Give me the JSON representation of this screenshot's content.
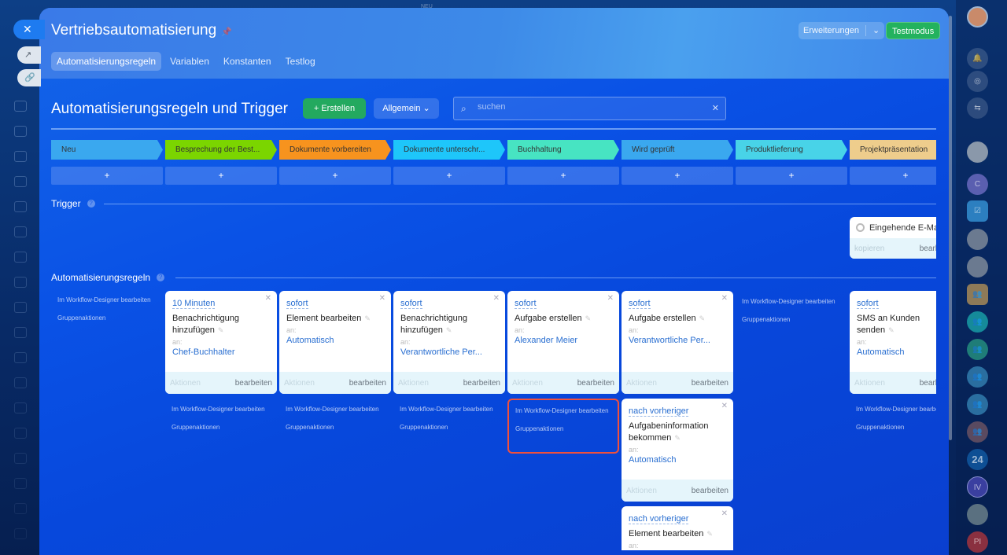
{
  "top_badge": "NEU",
  "left_sidebar": {
    "close": "✕",
    "open_icon": "↗",
    "link_icon": "🔗",
    "icons": [
      "feed-icon",
      "chat-icon",
      "contacts-icon",
      "crm-icon",
      "tasks-icon",
      "mail-icon",
      "calendar-icon",
      "funnel-icon",
      "cards-icon",
      "cart-icon",
      "target-icon",
      "chart-icon",
      "phone-icon",
      "robot-icon",
      "store-icon",
      "box-icon",
      "pencil-icon",
      "check-icon"
    ]
  },
  "header": {
    "title": "Vertriebsautomatisierung",
    "tabs": [
      "Automatisierungsregeln",
      "Variablen",
      "Konstanten",
      "Testlog"
    ],
    "extensions": "Erweiterungen",
    "test_mode": "Testmodus"
  },
  "toolbar": {
    "title": "Automatisierungsregeln und Trigger",
    "create": "+ Erstellen",
    "general": "Allgemein ⌄",
    "search_placeholder": "suchen"
  },
  "stages": [
    {
      "label": "Neu",
      "color": "#3aa8ef"
    },
    {
      "label": "Besprechung der Best...",
      "color": "#7bd500"
    },
    {
      "label": "Dokumente vorbereiten",
      "color": "#f7931e"
    },
    {
      "label": "Dokumente unterschr...",
      "color": "#1ec6fa"
    },
    {
      "label": "Buchhaltung",
      "color": "#47e4c2"
    },
    {
      "label": "Wird geprüft",
      "color": "#3aa8ef"
    },
    {
      "label": "Produktlieferung",
      "color": "#48d3e8"
    },
    {
      "label": "Projektpräsentation",
      "color": "#eecd8c"
    }
  ],
  "triggers": {
    "heading": "Trigger",
    "card": {
      "title": "Eingehende E-Mail",
      "copy": "kopieren",
      "edit": "bearbeiten"
    }
  },
  "rules": {
    "heading": "Automatisierungsregeln",
    "link_designer": "Im Workflow-Designer bearbeiten",
    "link_group": "Gruppenaktionen",
    "to_label": "an:",
    "actions": "Aktionen",
    "edit": "bearbeiten",
    "columns": [
      {
        "cards": []
      },
      {
        "cards": [
          {
            "delay": "10 Minuten",
            "name": "Benachrichtigung hinzufügen",
            "to": "Chef-Buchhalter"
          }
        ]
      },
      {
        "cards": [
          {
            "delay": "sofort",
            "name": "Element bearbeiten",
            "to": "Automatisch"
          }
        ]
      },
      {
        "cards": [
          {
            "delay": "sofort",
            "name": "Benachrichtigung hinzufügen",
            "to": "Verantwortliche Per..."
          }
        ]
      },
      {
        "cards": [
          {
            "delay": "sofort",
            "name": "Aufgabe erstellen",
            "to": "Alexander Meier"
          }
        ]
      },
      {
        "cards": [
          {
            "delay": "sofort",
            "name": "Aufgabe erstellen",
            "to": "Verantwortliche Per..."
          },
          {
            "delay": "nach vorheriger",
            "name": "Aufgabeninformation bekommen",
            "to": "Automatisch"
          },
          {
            "delay": "nach vorheriger",
            "name": "Element bearbeiten",
            "to": ""
          }
        ]
      },
      {
        "cards": []
      },
      {
        "cards": [
          {
            "delay": "sofort",
            "name": "SMS an Kunden senden",
            "to": "Automatisch"
          }
        ]
      }
    ]
  },
  "right_sidebar": {
    "items": [
      "C",
      "24",
      "IV",
      "PI"
    ]
  }
}
